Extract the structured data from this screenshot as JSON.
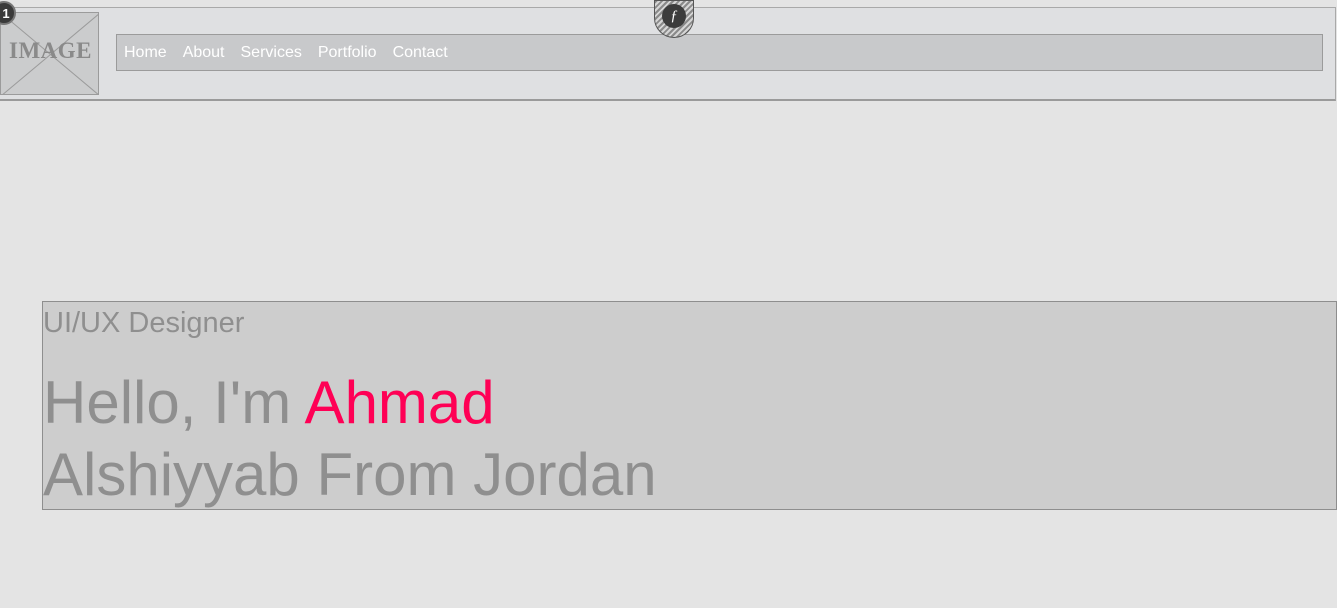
{
  "header": {
    "logo_text": "IMAGE",
    "badge_number": "1",
    "pin_symbol": "ƒ"
  },
  "nav": {
    "items": [
      {
        "label": "Home"
      },
      {
        "label": "About"
      },
      {
        "label": "Services"
      },
      {
        "label": "Portfolio"
      },
      {
        "label": "Contact"
      }
    ]
  },
  "hero": {
    "role": "UI/UX Designer",
    "greeting": "Hello, I'm",
    "first_name": "Ahmad",
    "line2": "Alshiyyab From Jordan"
  },
  "colors": {
    "accent": "#ff0055",
    "muted_text": "#8f8f8f",
    "page_bg": "#e4e4e4"
  }
}
